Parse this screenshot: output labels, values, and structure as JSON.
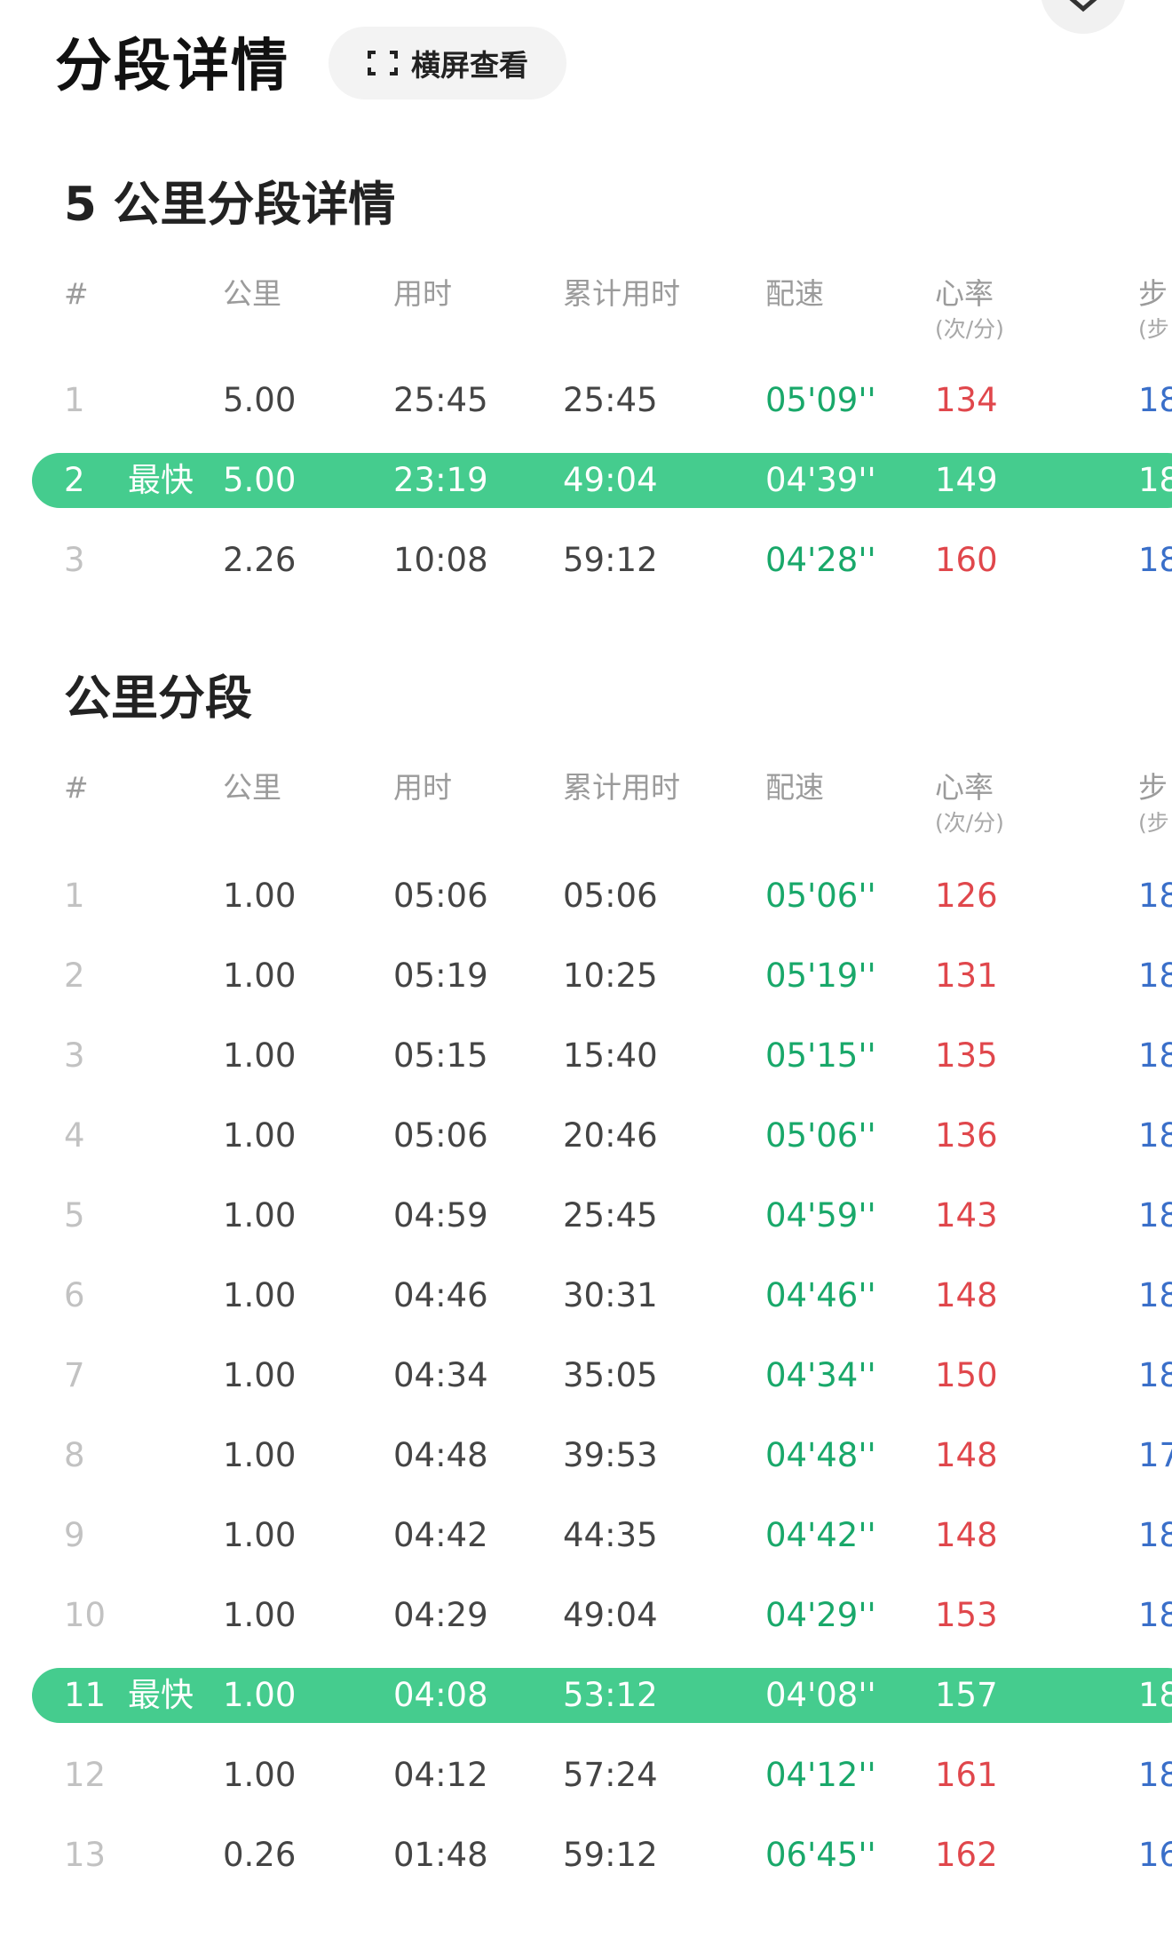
{
  "header": {
    "title": "分段详情",
    "landscape_label": "横屏查看",
    "close_icon": "close-icon",
    "landscape_icon": "expand-icon"
  },
  "columns": {
    "idx": "#",
    "km": "公里",
    "time": "用时",
    "cumulative": "累计用时",
    "pace": "配速",
    "hr": "心率",
    "hr_unit": "(次/分)",
    "cadence": "步",
    "cadence_unit": "(步"
  },
  "colors": {
    "fast_highlight": "#45cc8e",
    "pace": "#19a86a",
    "heart_rate": "#e0474c",
    "cadence": "#3a6fc9"
  },
  "five_km": {
    "title": "5 公里分段详情",
    "rows": [
      {
        "idx": "1",
        "badge": "",
        "km": "5.00",
        "time": "25:45",
        "cumulative": "25:45",
        "pace": "05'09''",
        "hr": "134",
        "cadence": "18",
        "fast": false
      },
      {
        "idx": "2",
        "badge": "最快",
        "km": "5.00",
        "time": "23:19",
        "cumulative": "49:04",
        "pace": "04'39''",
        "hr": "149",
        "cadence": "18",
        "fast": true
      },
      {
        "idx": "3",
        "badge": "",
        "km": "2.26",
        "time": "10:08",
        "cumulative": "59:12",
        "pace": "04'28''",
        "hr": "160",
        "cadence": "18",
        "fast": false
      }
    ]
  },
  "km_splits": {
    "title": "公里分段",
    "rows": [
      {
        "idx": "1",
        "badge": "",
        "km": "1.00",
        "time": "05:06",
        "cumulative": "05:06",
        "pace": "05'06''",
        "hr": "126",
        "cadence": "18",
        "fast": false
      },
      {
        "idx": "2",
        "badge": "",
        "km": "1.00",
        "time": "05:19",
        "cumulative": "10:25",
        "pace": "05'19''",
        "hr": "131",
        "cadence": "18",
        "fast": false
      },
      {
        "idx": "3",
        "badge": "",
        "km": "1.00",
        "time": "05:15",
        "cumulative": "15:40",
        "pace": "05'15''",
        "hr": "135",
        "cadence": "18",
        "fast": false
      },
      {
        "idx": "4",
        "badge": "",
        "km": "1.00",
        "time": "05:06",
        "cumulative": "20:46",
        "pace": "05'06''",
        "hr": "136",
        "cadence": "18",
        "fast": false
      },
      {
        "idx": "5",
        "badge": "",
        "km": "1.00",
        "time": "04:59",
        "cumulative": "25:45",
        "pace": "04'59''",
        "hr": "143",
        "cadence": "18",
        "fast": false
      },
      {
        "idx": "6",
        "badge": "",
        "km": "1.00",
        "time": "04:46",
        "cumulative": "30:31",
        "pace": "04'46''",
        "hr": "148",
        "cadence": "18",
        "fast": false
      },
      {
        "idx": "7",
        "badge": "",
        "km": "1.00",
        "time": "04:34",
        "cumulative": "35:05",
        "pace": "04'34''",
        "hr": "150",
        "cadence": "18",
        "fast": false
      },
      {
        "idx": "8",
        "badge": "",
        "km": "1.00",
        "time": "04:48",
        "cumulative": "39:53",
        "pace": "04'48''",
        "hr": "148",
        "cadence": "17",
        "fast": false
      },
      {
        "idx": "9",
        "badge": "",
        "km": "1.00",
        "time": "04:42",
        "cumulative": "44:35",
        "pace": "04'42''",
        "hr": "148",
        "cadence": "18",
        "fast": false
      },
      {
        "idx": "10",
        "badge": "",
        "km": "1.00",
        "time": "04:29",
        "cumulative": "49:04",
        "pace": "04'29''",
        "hr": "153",
        "cadence": "18",
        "fast": false
      },
      {
        "idx": "11",
        "badge": "最快",
        "km": "1.00",
        "time": "04:08",
        "cumulative": "53:12",
        "pace": "04'08''",
        "hr": "157",
        "cadence": "18",
        "fast": true
      },
      {
        "idx": "12",
        "badge": "",
        "km": "1.00",
        "time": "04:12",
        "cumulative": "57:24",
        "pace": "04'12''",
        "hr": "161",
        "cadence": "18",
        "fast": false
      },
      {
        "idx": "13",
        "badge": "",
        "km": "0.26",
        "time": "01:48",
        "cumulative": "59:12",
        "pace": "06'45''",
        "hr": "162",
        "cadence": "16",
        "fast": false
      }
    ]
  }
}
